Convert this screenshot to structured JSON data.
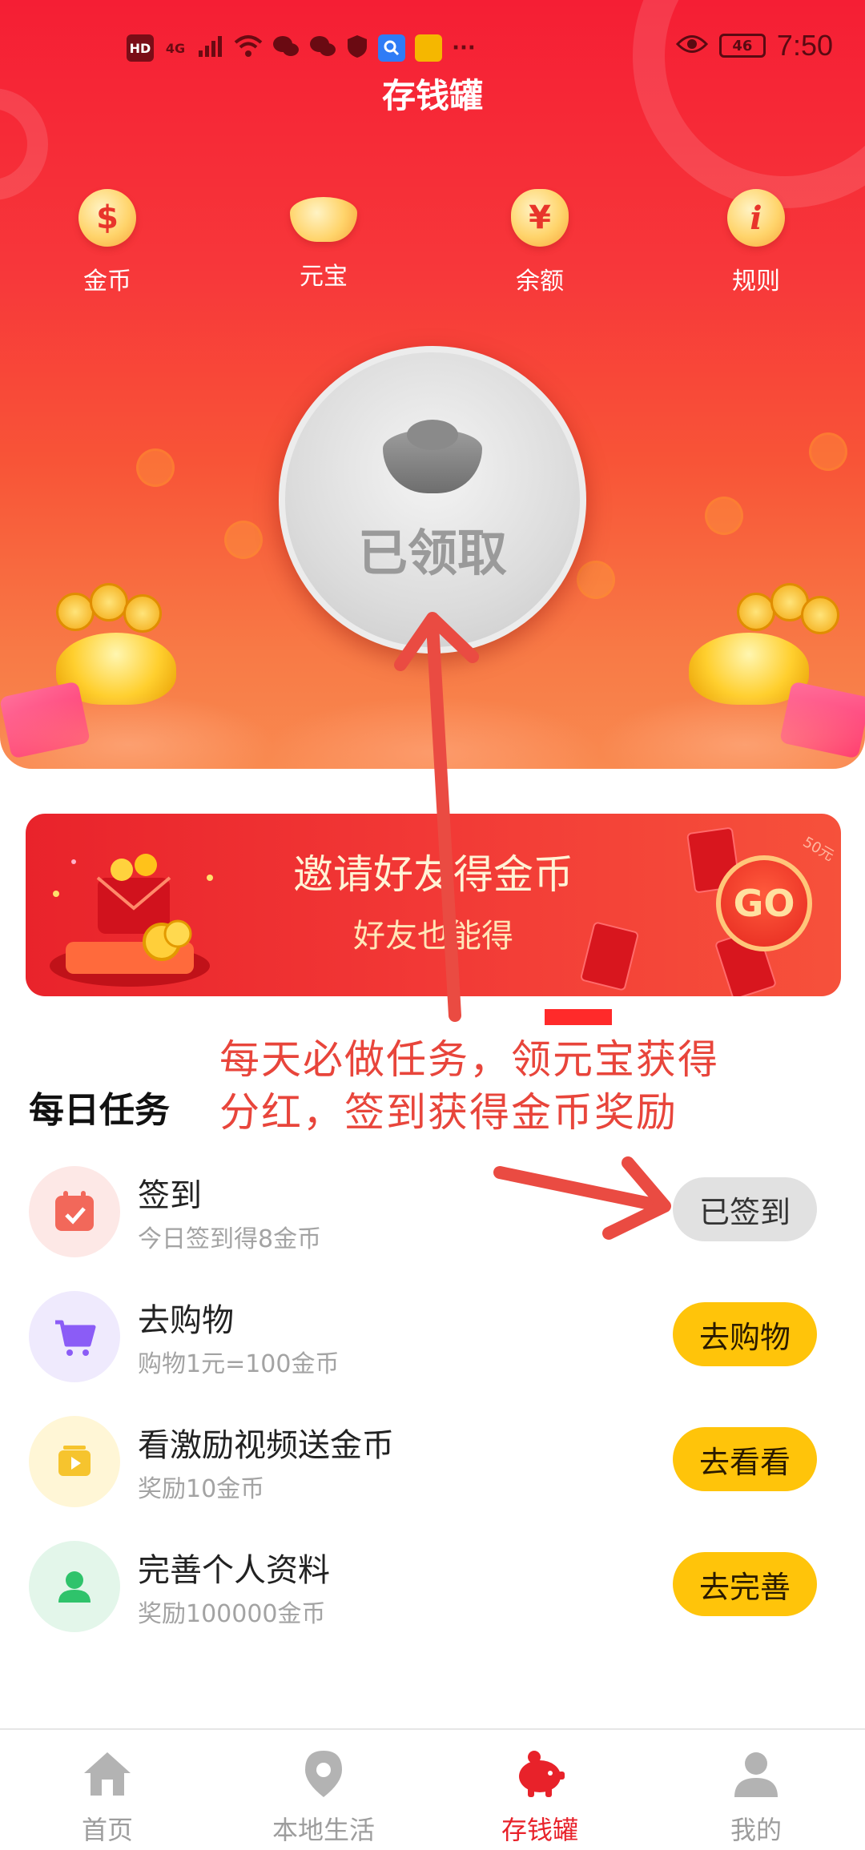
{
  "status_bar": {
    "left_icons": [
      "HD",
      "4G",
      "signal-icon",
      "wifi-icon",
      "wechat-icon",
      "wechat-icon",
      "shield-icon",
      "search-app-icon",
      "gallery-app-icon",
      "more-icon"
    ],
    "hd": "HD",
    "network": "4G",
    "more": "···",
    "eye": "eye-icon",
    "battery": "46",
    "time": "7:50"
  },
  "header": {
    "title": "存钱罐",
    "nav": [
      {
        "label": "金币",
        "icon": "coin-icon",
        "glyph": "$"
      },
      {
        "label": "元宝",
        "icon": "ingot-icon",
        "glyph": ""
      },
      {
        "label": "余额",
        "icon": "money-bag-icon",
        "glyph": "¥"
      },
      {
        "label": "规则",
        "icon": "info-icon",
        "glyph": "i"
      }
    ],
    "claim_status": "已领取"
  },
  "invite_banner": {
    "title": "邀请好友得金币",
    "subtitle": "好友也能得",
    "go_label": "GO",
    "envelope_tag": "50元"
  },
  "annotation": {
    "text_line1": "每天必做任务，领元宝获得",
    "text_line2": "分红，签到获得金币奖励",
    "color": "#e8453b"
  },
  "daily_tasks": {
    "title": "每日任务",
    "items": [
      {
        "title": "签到",
        "desc": "今日签到得8金币",
        "button": "已签到",
        "icon": "calendar-check-icon",
        "icon_bg": "#fde8e6",
        "icon_color": "#f2685a",
        "done": true
      },
      {
        "title": "去购物",
        "desc": "购物1元=100金币",
        "button": "去购物",
        "icon": "cart-icon",
        "icon_bg": "#efeafd",
        "icon_color": "#8b5cf6",
        "done": false
      },
      {
        "title": "看激励视频送金币",
        "desc": "奖励10金币",
        "button": "去看看",
        "icon": "video-icon",
        "icon_bg": "#fff6d6",
        "icon_color": "#f6c42e",
        "done": false
      },
      {
        "title": "完善个人资料",
        "desc": "奖励100000金币",
        "button": "去完善",
        "icon": "user-icon",
        "icon_bg": "#e3f6ea",
        "icon_color": "#2fc36b",
        "done": false
      }
    ]
  },
  "tabbar": {
    "items": [
      {
        "label": "首页",
        "icon": "home-icon",
        "active": false
      },
      {
        "label": "本地生活",
        "icon": "location-pin-icon",
        "active": false
      },
      {
        "label": "存钱罐",
        "icon": "piggy-bank-icon",
        "active": true
      },
      {
        "label": "我的",
        "icon": "profile-icon",
        "active": false
      }
    ]
  },
  "colors": {
    "brand_red": "#f51e34",
    "button_yellow": "#ffc40a",
    "active_tab": "#e8222a",
    "inactive_tab": "#9d9d9d"
  }
}
